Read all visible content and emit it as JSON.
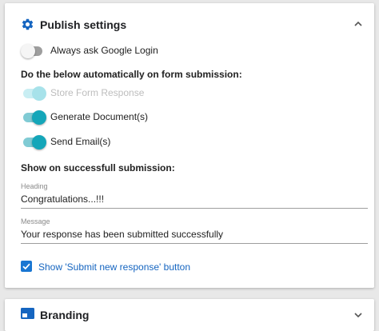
{
  "publish": {
    "title": "Publish settings",
    "google_login_label": "Always ask Google Login",
    "auto_heading": "Do the below automatically on form submission:",
    "store_label": "Store Form Response",
    "generate_label": "Generate Document(s)",
    "email_label": "Send Email(s)",
    "success_heading": "Show on successfull submission:",
    "heading_field": {
      "label": "Heading",
      "value": "Congratulations...!!!"
    },
    "message_field": {
      "label": "Message",
      "value": "Your response has been submitted successfully"
    },
    "submit_new_label": "Show 'Submit new response' button"
  },
  "toggles": {
    "google_login": false,
    "store_form_response": true,
    "generate_documents": true,
    "send_emails": true
  },
  "checkbox_checked": true,
  "branding": {
    "title": "Branding"
  },
  "colors": {
    "accent_teal": "#14a6b9",
    "checkbox_blue": "#1976d2",
    "icon_blue": "#1565c0"
  },
  "icons": {
    "publish": "gear-icon",
    "branding": "branding-icon",
    "collapse": "chevron-up-icon",
    "expand": "chevron-down-icon"
  }
}
